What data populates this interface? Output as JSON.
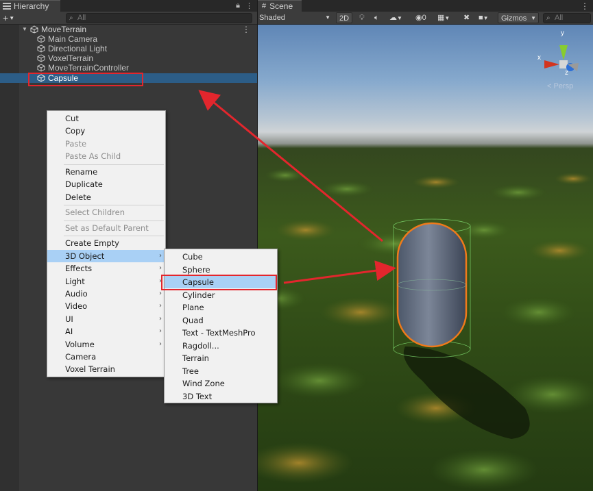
{
  "hierarchy": {
    "tab_title": "Hierarchy",
    "add_button": "+",
    "search_placeholder": "All",
    "root": "MoveTerrain",
    "items": [
      "Main Camera",
      "Directional Light",
      "VoxelTerrain",
      "MoveTerrainController",
      "Capsule"
    ],
    "selected_item": "Capsule"
  },
  "scene": {
    "tab_title": "Scene",
    "shading_mode": "Shaded",
    "mode_2d": "2D",
    "hidden_count": "0",
    "gizmos_label": "Gizmos",
    "search_placeholder": "All",
    "persp_label": "< Persp",
    "axis_labels": {
      "x": "x",
      "y": "y",
      "z": "z"
    }
  },
  "context_menu": {
    "groups": [
      [
        {
          "label": "Cut"
        },
        {
          "label": "Copy"
        },
        {
          "label": "Paste",
          "disabled": true
        },
        {
          "label": "Paste As Child",
          "disabled": true
        }
      ],
      [
        {
          "label": "Rename"
        },
        {
          "label": "Duplicate"
        },
        {
          "label": "Delete"
        }
      ],
      [
        {
          "label": "Select Children",
          "disabled": true
        }
      ],
      [
        {
          "label": "Set as Default Parent",
          "disabled": true
        }
      ],
      [
        {
          "label": "Create Empty"
        },
        {
          "label": "3D Object",
          "submenu": true,
          "highlighted": true
        },
        {
          "label": "Effects",
          "submenu": true
        },
        {
          "label": "Light",
          "submenu": true
        },
        {
          "label": "Audio",
          "submenu": true
        },
        {
          "label": "Video",
          "submenu": true
        },
        {
          "label": "UI",
          "submenu": true
        },
        {
          "label": "AI",
          "submenu": true
        },
        {
          "label": "Volume",
          "submenu": true
        },
        {
          "label": "Camera"
        },
        {
          "label": "Voxel Terrain"
        }
      ]
    ]
  },
  "submenu_3d_object": {
    "items": [
      "Cube",
      "Sphere",
      "Capsule",
      "Cylinder",
      "Plane",
      "Quad",
      "Text - TextMeshPro",
      "Ragdoll...",
      "Terrain",
      "Tree",
      "Wind Zone",
      "3D Text"
    ],
    "highlighted": "Capsule"
  },
  "colors": {
    "selection": "#2c5d87",
    "menu_highlight": "#a9d0f5",
    "annotation_red": "#e3262d",
    "capsule_outline": "#f07a1a"
  }
}
